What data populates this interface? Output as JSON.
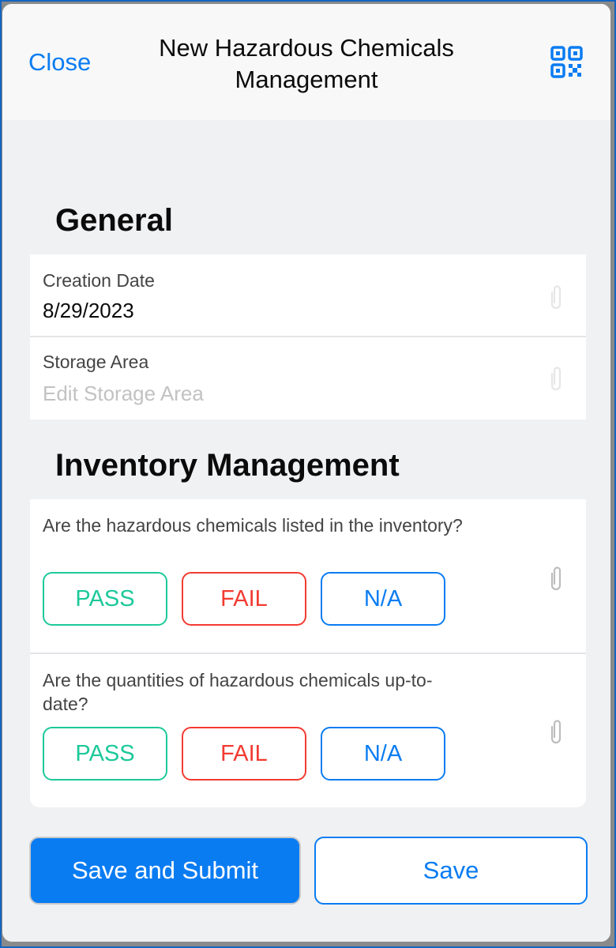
{
  "header": {
    "close_label": "Close",
    "title": "New Hazardous Chemicals Management",
    "qr_icon": "qr-code-icon"
  },
  "sections": [
    {
      "title": "General",
      "fields": [
        {
          "label": "Creation Date",
          "value": "8/29/2023",
          "attachment_icon": "paperclip-icon"
        },
        {
          "label": "Storage Area",
          "placeholder": "Edit Storage Area",
          "attachment_icon": "paperclip-icon"
        }
      ]
    },
    {
      "title": "Inventory Management",
      "questions": [
        {
          "text": "Are the hazardous chemicals listed in the inventory?",
          "options": [
            "PASS",
            "FAIL",
            "N/A"
          ],
          "attachment_icon": "paperclip-icon"
        },
        {
          "text": "Are the quantities of hazardous chemicals up-to-date?",
          "options": [
            "PASS",
            "FAIL",
            "N/A"
          ],
          "attachment_icon": "paperclip-icon"
        }
      ]
    }
  ],
  "footer": {
    "submit_label": "Save and Submit",
    "save_label": "Save"
  },
  "colors": {
    "accent": "#0a7cf2",
    "pass": "#1dc99a",
    "fail": "#f23b31",
    "background": "#f0f1f3"
  }
}
